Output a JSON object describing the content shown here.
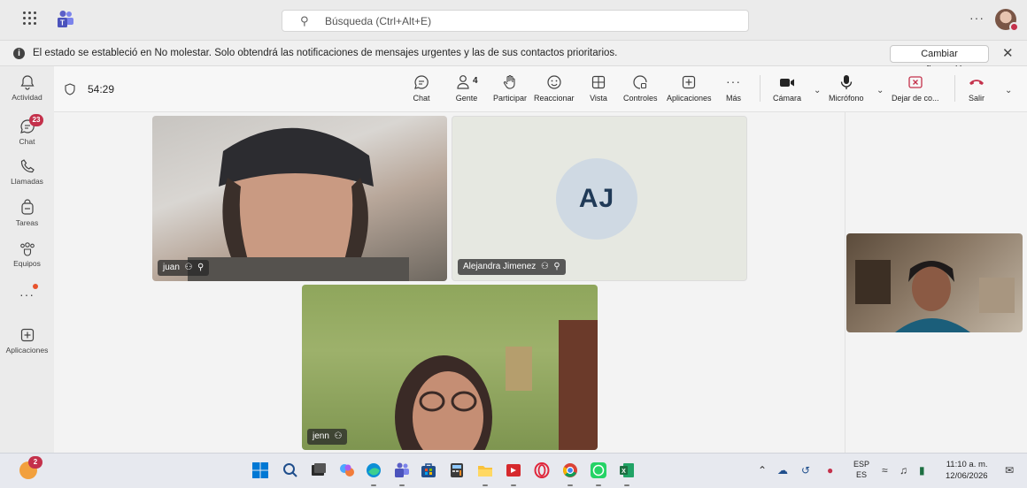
{
  "titlebar": {
    "search_placeholder": "Búsqueda (Ctrl+Alt+E)",
    "more_label": "···",
    "icons": [
      "apps-grid-icon",
      "teams-logo",
      "search-icon",
      "more-icon",
      "profile-avatar"
    ]
  },
  "notice": {
    "text": "El estado se estableció en No molestar. Solo obtendrá las notificaciones de mensajes urgentes y las de sus contactos prioritarios.",
    "config_button": "Cambiar configuración",
    "close": "✕"
  },
  "rail": {
    "items": [
      {
        "label": "Actividad",
        "icon": "bell-icon"
      },
      {
        "label": "Chat",
        "icon": "chat-icon",
        "badge": "23"
      },
      {
        "label": "Llamadas",
        "icon": "phone-icon"
      },
      {
        "label": "Tareas",
        "icon": "tasks-icon"
      },
      {
        "label": "Equipos",
        "icon": "teams-icon"
      },
      {
        "label": "",
        "icon": "more-icon"
      },
      {
        "label": "Aplicaciones",
        "icon": "add-apps-icon"
      }
    ],
    "more_label": "···"
  },
  "meeting": {
    "timer": "54:29",
    "people_count": "4",
    "buttons": {
      "chat": "Chat",
      "people": "Gente",
      "raise": "Participar",
      "react": "Reaccionar",
      "view": "Vista",
      "controls": "Controles",
      "apps": "Aplicaciones",
      "more": "Más",
      "camera": "Cámara",
      "mic": "Micrófono",
      "share": "Dejar de co...",
      "leave": "Salir"
    }
  },
  "participants": [
    {
      "name": "juan",
      "initials": ""
    },
    {
      "name": "Alejandra Jimenez",
      "initials": "AJ"
    },
    {
      "name": "jenn",
      "initials": ""
    }
  ],
  "taskbar": {
    "weather_badge": "2",
    "lang_top": "ESP",
    "lang_bottom": "ES",
    "time": "11:10 a. m.",
    "date": "12/06/2026",
    "colors": {
      "windows": "#0078d4",
      "teams": "#5b5fc7",
      "edge": "#0c8fd6",
      "excel": "#1d6f42",
      "whatsapp": "#25d366",
      "opera": "#e0263a"
    }
  }
}
